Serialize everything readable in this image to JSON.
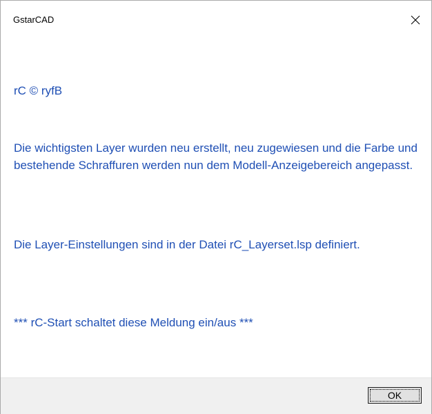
{
  "window": {
    "title": "GstarCAD",
    "close_icon": "close-icon"
  },
  "message": {
    "line1": "rC © ryfB",
    "line2": "Die wichtigsten Layer wurden neu erstellt, neu zugewiesen und die Farbe und bestehende Schraffuren werden nun dem Modell-Anzeigebereich angepasst.",
    "line3": "Die Layer-Einstellungen sind in der Datei rC_Layerset.lsp definiert.",
    "line4": "*** rC-Start schaltet diese Meldung ein/aus ***"
  },
  "buttons": {
    "ok_label": "OK"
  },
  "colors": {
    "message_text": "#1f4fb4",
    "footer_bg": "#f0f0f0"
  }
}
